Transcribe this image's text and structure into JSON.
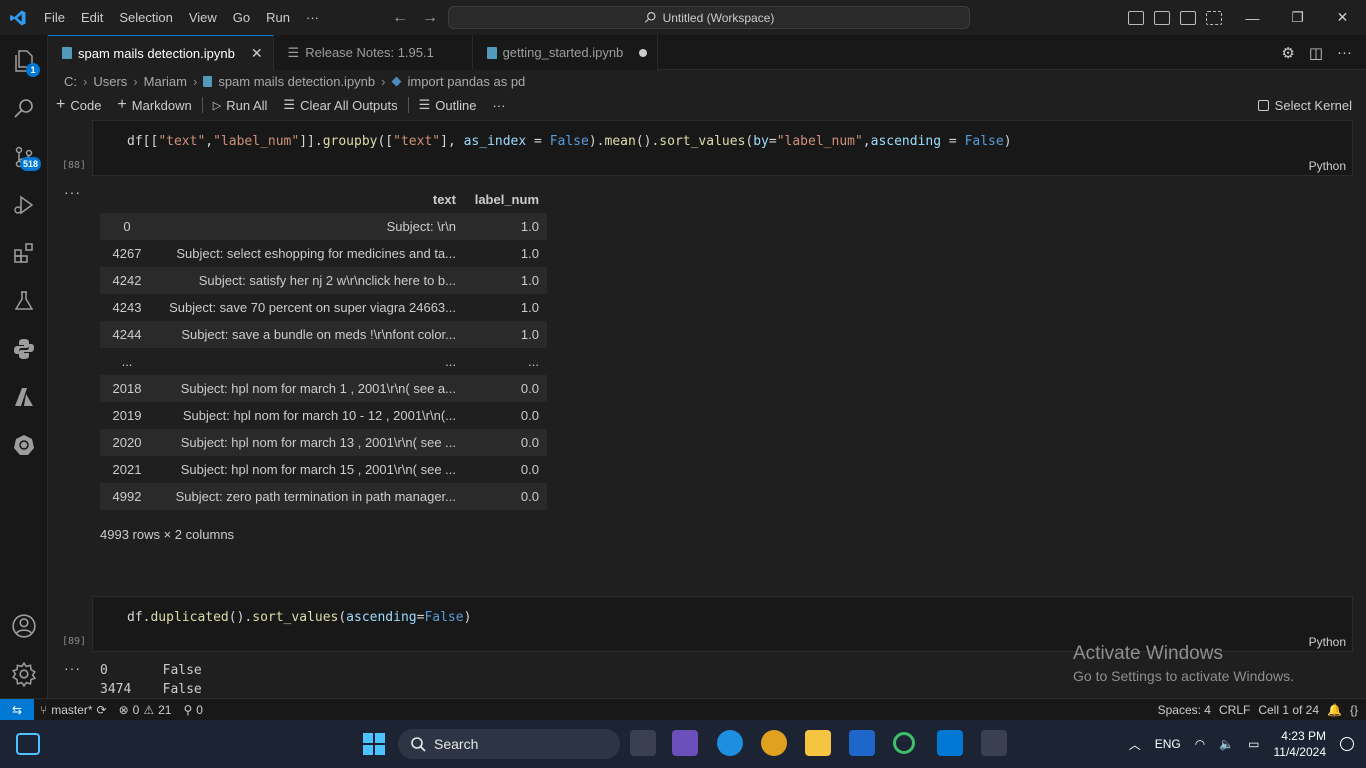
{
  "titlebar": {
    "menu": [
      "File",
      "Edit",
      "Selection",
      "View",
      "Go",
      "Run",
      "···"
    ],
    "command_center": "Untitled (Workspace)"
  },
  "activity": {
    "explorer_badge": "1",
    "scm_badge": "518"
  },
  "tabs": [
    {
      "label": "spam mails detection.ipynb",
      "active": true
    },
    {
      "label": "Release Notes: 1.95.1",
      "active": false
    },
    {
      "label": "getting_started.ipynb",
      "active": false
    }
  ],
  "breadcrumb": [
    "C:",
    "Users",
    "Mariam",
    "spam mails detection.ipynb",
    "import pandas as pd"
  ],
  "toolbar": {
    "code": "Code",
    "markdown": "Markdown",
    "run_all": "Run All",
    "clear": "Clear All Outputs",
    "outline": "Outline",
    "more": "···",
    "kernel": "Select Kernel"
  },
  "cells": [
    {
      "exec": "[88]",
      "lang": "Python",
      "code": "df[[\"text\",\"label_num\"]].groupby([\"text\"], as_index = False).mean().sort_values(by=\"label_num\",ascending = False)",
      "output": {
        "columns": [
          "",
          "text",
          "label_num"
        ],
        "rows": [
          [
            "0",
            "Subject: \\r\\n",
            "1.0"
          ],
          [
            "4267",
            "Subject: select eshopping for medicines and ta...",
            "1.0"
          ],
          [
            "4242",
            "Subject: satisfy her nj 2 w\\r\\nclick here to b...",
            "1.0"
          ],
          [
            "4243",
            "Subject: save 70 percent on super viagra 24663...",
            "1.0"
          ],
          [
            "4244",
            "Subject: save a bundle on meds !\\r\\nfont color...",
            "1.0"
          ],
          [
            "...",
            "...",
            "..."
          ],
          [
            "2018",
            "Subject: hpl nom for march 1 , 2001\\r\\n( see a...",
            "0.0"
          ],
          [
            "2019",
            "Subject: hpl nom for march 10 - 12 , 2001\\r\\n(...",
            "0.0"
          ],
          [
            "2020",
            "Subject: hpl nom for march 13 , 2001\\r\\n( see ...",
            "0.0"
          ],
          [
            "2021",
            "Subject: hpl nom for march 15 , 2001\\r\\n( see ...",
            "0.0"
          ],
          [
            "4992",
            "Subject: zero path termination in path manager...",
            "0.0"
          ]
        ],
        "shape": "4993 rows × 2 columns"
      }
    },
    {
      "exec": "[89]",
      "lang": "Python",
      "code": "df.duplicated().sort_values(ascending=False)",
      "output": {
        "series": [
          "0       False",
          "3474    False"
        ]
      }
    }
  ],
  "watermark": {
    "line1": "Activate Windows",
    "line2": "Go to Settings to activate Windows."
  },
  "statusbar": {
    "branch": "master*",
    "errors": "0",
    "warnings": "21",
    "ports": "0",
    "spaces": "Spaces: 4",
    "eol": "CRLF",
    "cell": "Cell 1 of 24",
    "braces": "{}"
  },
  "taskbar": {
    "search": "Search",
    "lang": "ENG",
    "time": "4:23 PM",
    "date": "11/4/2024"
  },
  "colors": {
    "accent": "#0078d4",
    "string": "#ce9178",
    "keyword": "#569cd6"
  }
}
